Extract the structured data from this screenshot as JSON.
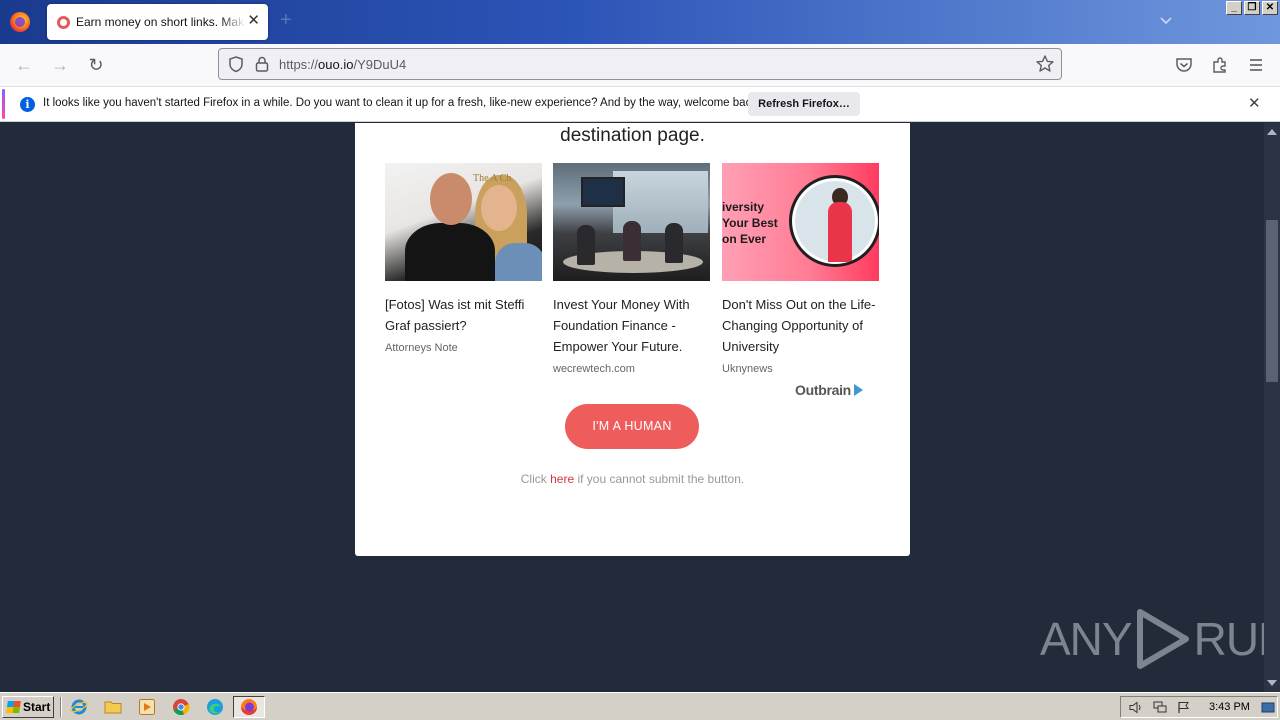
{
  "browser": {
    "tab": {
      "title": "Earn money on short links. Make short links and earn money"
    },
    "url": {
      "scheme": "https://",
      "host": "ouo.io",
      "path": "/Y9DuU4"
    },
    "notification": {
      "text": "It looks like you haven't started Firefox in a while. Do you want to clean it up for a fresh, like-new experience? And by the way, welcome back!",
      "button": "Refresh Firefox…"
    }
  },
  "page": {
    "destination_text": "destination page.",
    "ads": [
      {
        "title": "[Fotos] Was ist mit Steffi Graf passiert?",
        "source": "Attorneys Note",
        "image_text": "The A Ch"
      },
      {
        "title": "Invest Your Money With Foundation Finance - Empower Your Future.",
        "source": "wecrewtech.com"
      },
      {
        "title": "Don't Miss Out on the Life-Changing Opportunity of University",
        "source": "Uknynews",
        "image_text": "iversity Your Best on Ever"
      }
    ],
    "outbrain_label": "Outbrain",
    "human_button": "I'M A HUMAN",
    "click_prefix": "Click ",
    "click_link": "here",
    "click_suffix": " if you cannot submit the button."
  },
  "watermark": {
    "left": "ANY",
    "right": "RUN"
  },
  "taskbar": {
    "start": "Start",
    "clock": "3:43 PM"
  },
  "colors": {
    "page_background": "#222b3a",
    "human_button": "#ee5c5c",
    "link": "#d9363e"
  }
}
